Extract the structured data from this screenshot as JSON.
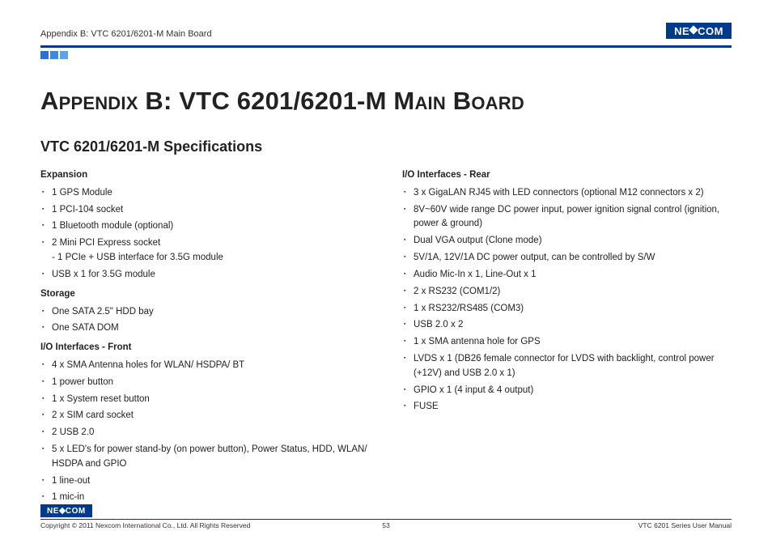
{
  "header": {
    "breadcrumb": "Appendix B: VTC 6201/6201-M Main Board",
    "logo_text_pre": "NE",
    "logo_text_post": "COM"
  },
  "title": "Appendix B: VTC 6201/6201-M Main Board",
  "section_title": "VTC 6201/6201-M Specifications",
  "left": {
    "expansion": {
      "heading": "Expansion",
      "items": [
        "1 GPS Module",
        "1 PCI-104 socket",
        "1 Bluetooth module (optional)",
        "2 Mini PCI Express socket",
        "USB x 1 for 3.5G module"
      ],
      "sub_item_4": "- 1 PCIe + USB interface for 3.5G module"
    },
    "storage": {
      "heading": "Storage",
      "items": [
        "One SATA 2.5\" HDD bay",
        "One SATA DOM"
      ]
    },
    "io_front": {
      "heading": "I/O Interfaces - Front",
      "items": [
        "4 x SMA Antenna holes for WLAN/ HSDPA/ BT",
        "1 power button",
        "1 x System reset button",
        "2 x SIM card socket",
        "2 USB 2.0",
        "5 x LED's for power stand-by (on power button), Power Status, HDD, WLAN/ HSDPA and GPIO",
        "1 line-out",
        "1 mic-in"
      ]
    }
  },
  "right": {
    "io_rear": {
      "heading": "I/O Interfaces - Rear",
      "items": [
        "3 x GigaLAN RJ45 with LED connectors (optional M12 connectors x 2)",
        "8V~60V wide range DC power input, power ignition signal control (ignition, power & ground)",
        "Dual VGA output (Clone mode)",
        "5V/1A, 12V/1A DC power output, can be controlled by S/W",
        "Audio Mic-In x 1, Line-Out x 1",
        "2 x RS232 (COM1/2)",
        "1 x RS232/RS485 (COM3)",
        "USB 2.0 x 2",
        "1 x SMA antenna hole for GPS",
        "LVDS x 1 (DB26 female connector for LVDS with backlight, control power (+12V) and USB 2.0 x 1)",
        "GPIO x 1 (4 input & 4 output)",
        "FUSE"
      ]
    }
  },
  "footer": {
    "copyright": "Copyright © 2011 Nexcom International Co., Ltd. All Rights Reserved",
    "page": "53",
    "doc": "VTC 6201 Series User Manual"
  }
}
